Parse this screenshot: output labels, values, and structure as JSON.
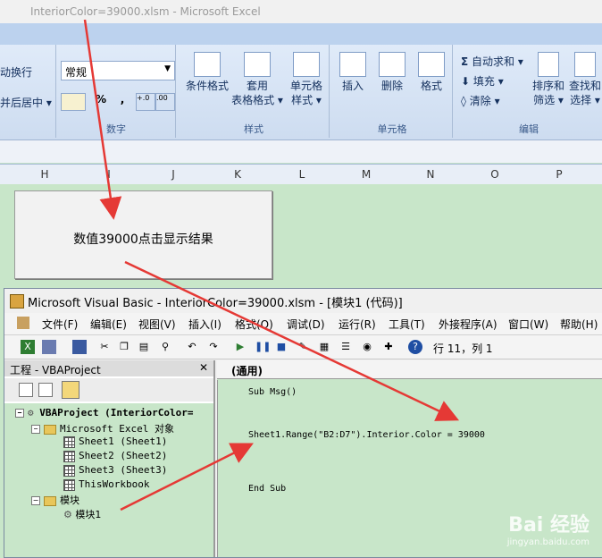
{
  "excel": {
    "title": "InteriorColor=39000.xlsm - Microsoft Excel",
    "ribbon": {
      "wrap_text": "动换行",
      "merge_center": "并后居中 ▾",
      "number_format": "常规",
      "group_number": "数字",
      "percent": "%",
      "comma": ",",
      "cond_format": "条件格式",
      "table_format_1": "套用",
      "table_format_2": "表格格式 ▾",
      "cell_style_1": "单元格",
      "cell_style_2": "样式 ▾",
      "group_styles": "样式",
      "insert": "插入",
      "delete": "删除",
      "format": "格式",
      "group_cells": "单元格",
      "autosum": "自动求和 ▾",
      "fill": "填充 ▾",
      "clear": "清除 ▾",
      "sort_filter_1": "排序和",
      "sort_filter_2": "筛选 ▾",
      "find_select_1": "查找和",
      "find_select_2": "选择 ▾",
      "group_editing": "编辑"
    },
    "columns": [
      "H",
      "I",
      "J",
      "K",
      "L",
      "M",
      "N",
      "O",
      "P"
    ],
    "macro_button": "数值39000点击显示结果"
  },
  "vbe": {
    "title": "Microsoft Visual Basic - InteriorColor=39000.xlsm - [模块1 (代码)]",
    "menu": [
      "文件(F)",
      "编辑(E)",
      "视图(V)",
      "插入(I)",
      "格式(O)",
      "调试(D)",
      "运行(R)",
      "工具(T)",
      "外接程序(A)",
      "窗口(W)",
      "帮助(H)"
    ],
    "cursor_pos": "行 11，列 1",
    "project_title": "工程 - VBAProject",
    "close": "✕",
    "tree": {
      "root": "VBAProject (InteriorColor=",
      "objects": "Microsoft Excel 对象",
      "sheet1": "Sheet1 (Sheet1)",
      "sheet2": "Sheet2 (Sheet2)",
      "sheet3": "Sheet3 (Sheet3)",
      "workbook": "ThisWorkbook",
      "modules": "模块",
      "module1": "模块1"
    },
    "code_object": "(通用)",
    "code": [
      "Sub Msg()",
      "Sheet1.Range(\"B2:D7\").Interior.Color = 39000",
      "End Sub"
    ]
  },
  "watermark": {
    "brand": "Bai  经验",
    "url": "jingyan.baidu.com"
  },
  "colors": {
    "sheet_bg": "#c8e6c9",
    "arrow": "#e53935",
    "ribbon": "#dbe7f7"
  }
}
